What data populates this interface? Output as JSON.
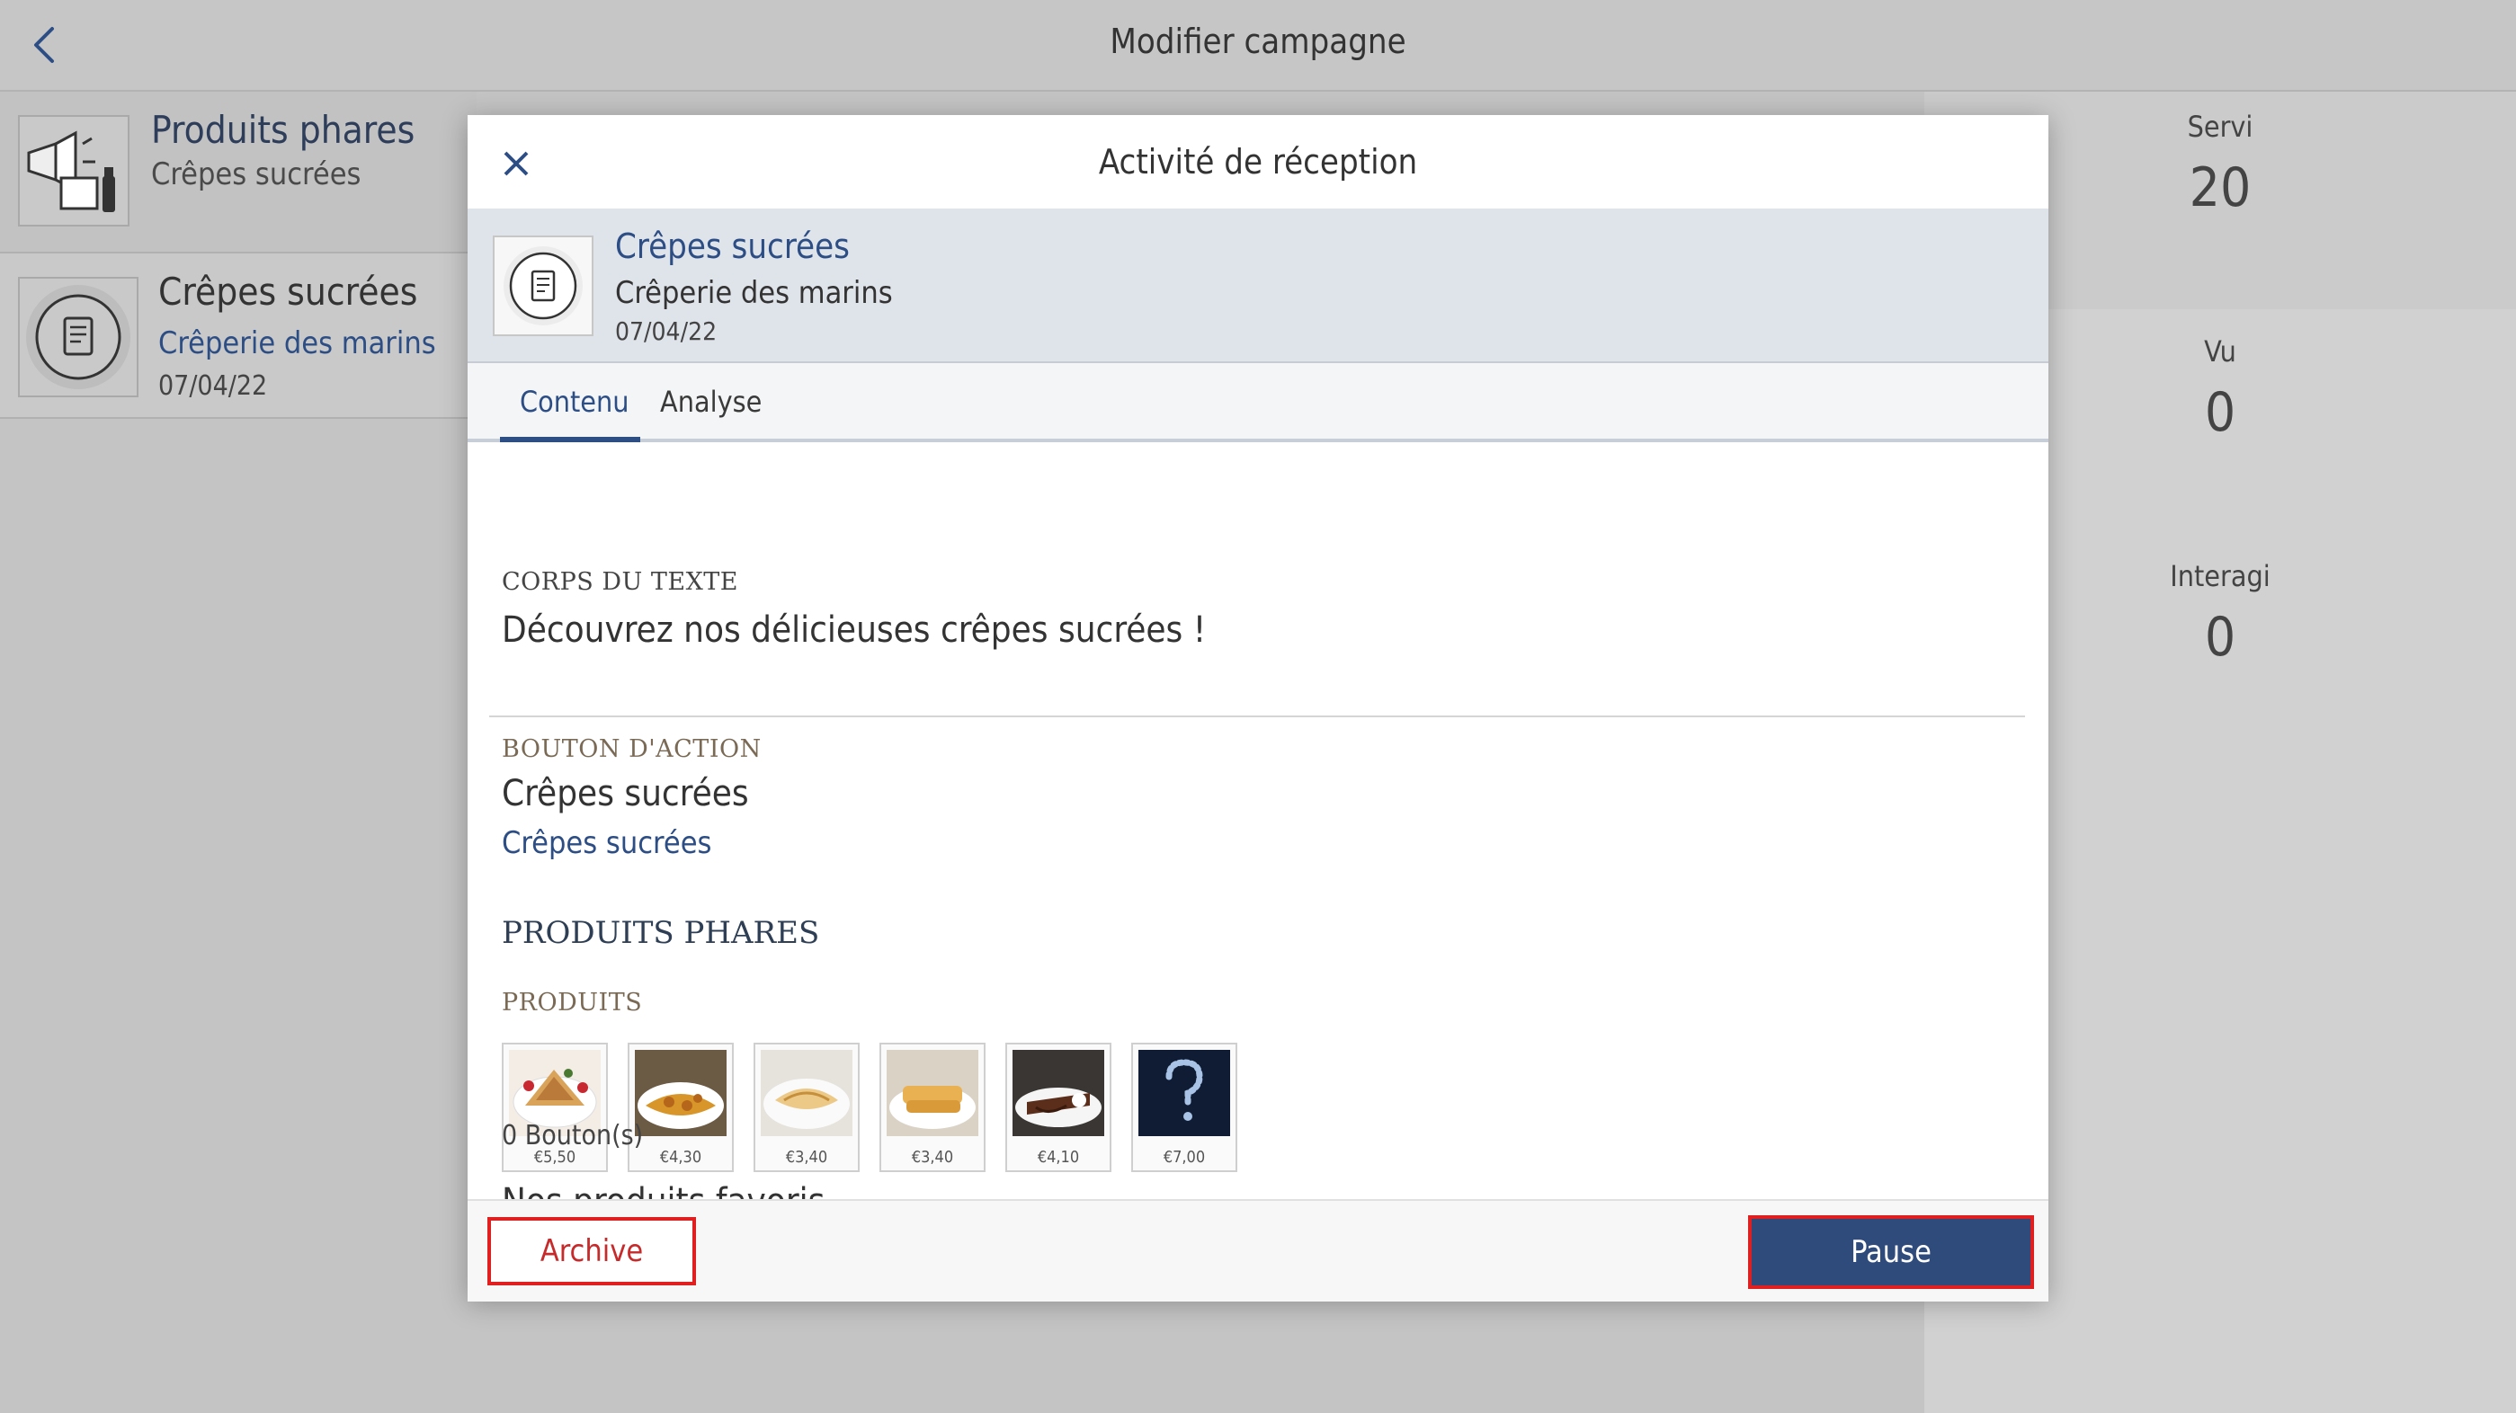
{
  "header": {
    "title": "Modifier campagne"
  },
  "campaigns": [
    {
      "title": "Produits phares",
      "subtitle": "Crêpes sucrées"
    },
    {
      "title": "Crêpes sucrées",
      "subtitle": "Crêperie des marins",
      "date": "07/04/22"
    }
  ],
  "stats": [
    {
      "label": "Servi",
      "value": "20"
    },
    {
      "label": "Vu",
      "value": "0"
    },
    {
      "label": "Interagi",
      "value": "0"
    }
  ],
  "modal": {
    "title": "Activité de réception",
    "info": {
      "title": "Crêpes sucrées",
      "subtitle": "Crêperie des marins",
      "date": "07/04/22"
    },
    "tabs": [
      {
        "label": "Contenu"
      },
      {
        "label": "Analyse"
      }
    ],
    "body_label": "CORPS DU TEXTE",
    "body_text": "Découvrez nos délicieuses crêpes sucrées !",
    "action_label": "BOUTON D'ACTION",
    "action_title": "Crêpes sucrées",
    "action_link": "Crêpes sucrées",
    "section_heading": "PRODUITS PHARES",
    "products_label": "PRODUITS",
    "products": [
      {
        "price": "€5,50"
      },
      {
        "price": "€4,30"
      },
      {
        "price": "€3,40"
      },
      {
        "price": "€3,40"
      },
      {
        "price": "€4,10"
      },
      {
        "price": "€7,00"
      }
    ],
    "favorites_title": "Nos produits favoris",
    "favorites_sub": "0 Bouton(s)",
    "archive_label": "Archive",
    "pause_label": "Pause"
  },
  "colors": {
    "accent": "#2d4e85",
    "pause_bg": "#2f4b7c",
    "highlight_border": "#e02020"
  }
}
